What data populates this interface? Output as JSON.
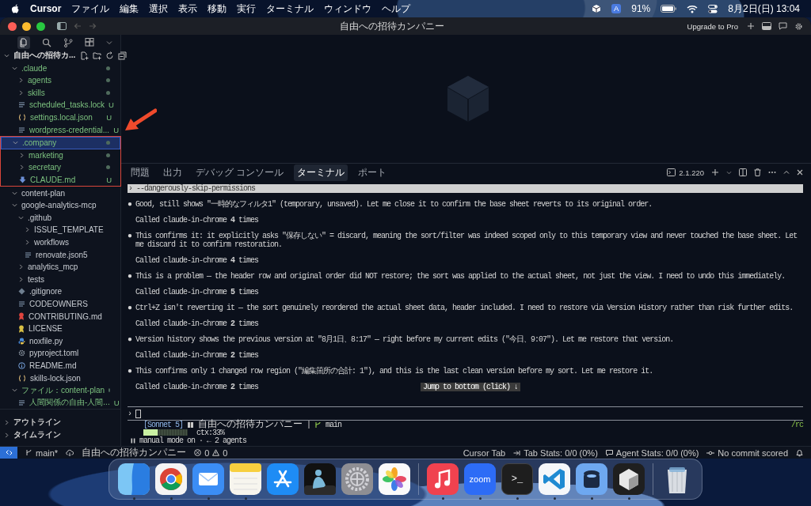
{
  "menubar": {
    "app": "Cursor",
    "menus": [
      "ファイル",
      "編集",
      "選択",
      "表示",
      "移動",
      "実行",
      "ターミナル",
      "ウィンドウ",
      "ヘルプ"
    ],
    "input_source": "A",
    "battery": "91%",
    "clock": "8月2日(日)  13:04"
  },
  "window": {
    "title": "自由への招待カンパニー",
    "upgrade": "Upgrade to Pro"
  },
  "sidebar": {
    "header": "自由への招待カ...",
    "tree": [
      {
        "name": ".claude",
        "kind": "folder",
        "expanded": true,
        "modified": true,
        "selected": false,
        "annotated": false,
        "children": [
          {
            "name": "agents",
            "kind": "folder",
            "expanded": false,
            "modified": true,
            "selected": false
          },
          {
            "name": "skills",
            "kind": "folder",
            "expanded": false,
            "modified": true,
            "selected": false
          },
          {
            "name": "scheduled_tasks.lock",
            "kind": "lines",
            "modified": false,
            "badge": "U",
            "selected": false
          },
          {
            "name": "settings.local.json",
            "kind": "braces",
            "modified": false,
            "badge": "U",
            "selected": false
          },
          {
            "name": "wordpress-credential...",
            "kind": "lines",
            "modified": false,
            "badge": "U",
            "selected": false
          }
        ]
      },
      {
        "name": ".company",
        "kind": "folder",
        "expanded": true,
        "modified": true,
        "selected": true,
        "annotated": true,
        "children": [
          {
            "name": "marketing",
            "kind": "folder",
            "expanded": false,
            "modified": true,
            "selected": false
          },
          {
            "name": "secretary",
            "kind": "folder",
            "expanded": false,
            "modified": true,
            "selected": false
          },
          {
            "name": "CLAUDE.md",
            "kind": "markdown",
            "modified": false,
            "badge": "U",
            "selected": false
          }
        ]
      },
      {
        "name": "content-plan",
        "kind": "folder",
        "expanded": true,
        "modified": false,
        "selected": false,
        "annotated": false
      },
      {
        "name": "google-analytics-mcp",
        "kind": "folder",
        "expanded": true,
        "modified": false,
        "selected": false,
        "annotated": false,
        "children": [
          {
            "name": ".github",
            "kind": "folder",
            "expanded": true,
            "modified": false,
            "selected": false,
            "children": [
              {
                "name": "ISSUE_TEMPLATE",
                "kind": "folder",
                "expanded": false,
                "modified": false,
                "selected": false
              },
              {
                "name": "workflows",
                "kind": "folder",
                "expanded": false,
                "modified": false,
                "selected": false
              },
              {
                "name": "renovate.json5",
                "kind": "lines",
                "modified": false,
                "selected": false
              }
            ]
          },
          {
            "name": "analytics_mcp",
            "kind": "folder",
            "expanded": false,
            "modified": false,
            "selected": false
          },
          {
            "name": "tests",
            "kind": "folder",
            "expanded": false,
            "modified": false,
            "selected": false
          },
          {
            "name": ".gitignore",
            "kind": "diamond",
            "modified": false,
            "selected": false
          },
          {
            "name": "CODEOWNERS",
            "kind": "lines",
            "modified": false,
            "selected": false
          },
          {
            "name": "CONTRIBUTING.md",
            "kind": "contributing",
            "modified": false,
            "selected": false
          },
          {
            "name": "LICENSE",
            "kind": "license",
            "modified": false,
            "selected": false
          },
          {
            "name": "noxfile.py",
            "kind": "python",
            "modified": false,
            "selected": false
          },
          {
            "name": "pyproject.toml",
            "kind": "toml",
            "modified": false,
            "selected": false
          },
          {
            "name": "README.md",
            "kind": "readme",
            "modified": false,
            "selected": false
          },
          {
            "name": "skills-lock.json",
            "kind": "braces",
            "modified": false,
            "selected": false
          }
        ]
      },
      {
        "name": "ファイル：content-plan",
        "kind": "folder",
        "expanded": true,
        "modified": true,
        "selected": false,
        "annotated": false,
        "children": [
          {
            "name": "人間関係の自由-人間...",
            "kind": "lines",
            "modified": false,
            "badge": "U",
            "selected": false
          }
        ]
      }
    ],
    "sections": [
      {
        "label": "アウトライン",
        "expanded": false
      },
      {
        "label": "タイムライン",
        "expanded": false
      }
    ]
  },
  "panel": {
    "tabs": [
      {
        "label": "問題",
        "selected": false
      },
      {
        "label": "出力",
        "selected": false
      },
      {
        "label": "デバッグ コンソール",
        "selected": false
      },
      {
        "label": "ターミナル",
        "selected": true
      },
      {
        "label": "ポート",
        "selected": false
      }
    ],
    "version": "2.1.220"
  },
  "terminal": {
    "lines": [
      {
        "kind": "command",
        "prompt": "›",
        "text": "--dangerously-skip-permissions"
      },
      {
        "kind": "bullet",
        "marker": "●",
        "text": "Good, still shows \"一時的なフィルタ1\" (temporary, unsaved). Let me close it to confirm the base sheet reverts to its original order."
      },
      {
        "kind": "called",
        "text": "Called claude-in-chrome **4** times"
      },
      {
        "kind": "bullet",
        "marker": "●",
        "text": "This confirms it: it explicitly asks \"保存しない\" = discard, meaning the sort/filter was indeed scoped only to this temporary view and never touched the base sheet. Let me discard it to confirm restoration."
      },
      {
        "kind": "called",
        "text": "Called claude-in-chrome **4** times"
      },
      {
        "kind": "bullet",
        "marker": "●",
        "text": "This is a problem — the header row and original order did NOT restore; the sort was applied to the actual sheet, not just the view. I need to undo this immediately."
      },
      {
        "kind": "called",
        "text": "Called claude-in-chrome **5** times"
      },
      {
        "kind": "bullet",
        "marker": "●",
        "text": "Ctrl+Z isn't reverting it — the sort genuinely reordered the actual sheet data, header included. I need to restore via Version History rather than risk further edits."
      },
      {
        "kind": "called",
        "text": "Called claude-in-chrome **2** times"
      },
      {
        "kind": "bullet",
        "marker": "●",
        "text": "Version history shows the previous version at \"8月1日、8:17\" — right before my current edits (\"今日、9:07\"). Let me restore that version."
      },
      {
        "kind": "called",
        "text": "Called claude-in-chrome **2** times"
      },
      {
        "kind": "bullet",
        "marker": "●",
        "text": "This confirms only 1 changed row region (\"編集箇所の合計: 1\"), and this is the last clean version before my sort. Let me restore it."
      },
      {
        "kind": "called",
        "text": "Called claude-in-chrome **2** times",
        "jump": "Jump to bottom (click) ↓"
      }
    ],
    "prompt": "›",
    "status": {
      "model": "[Sonnet 5]",
      "folder": "自由への招待カンパニー",
      "separator": "|",
      "branch": "main",
      "command": "/rc",
      "level": 0.33,
      "context": "ctx:33%",
      "mode": "manual mode on · ← 2 agents"
    }
  },
  "status_bar": {
    "branch": "main*",
    "workspace": "自由への招待カンパニー",
    "errors": "0",
    "warnings": "0",
    "right": [
      {
        "kind": "plain",
        "text": "Cursor Tab"
      },
      {
        "kind": "tab",
        "text": "Tab Stats: 0/0 (0%)"
      },
      {
        "kind": "agent",
        "text": "Agent Stats: 0/0 (0%)"
      },
      {
        "kind": "commit",
        "text": "No commit scored"
      }
    ]
  },
  "dock": {
    "apps": [
      {
        "kind": "finder",
        "running": true
      },
      {
        "kind": "chrome",
        "running": true
      },
      {
        "kind": "mail",
        "running": true
      },
      {
        "kind": "notes",
        "running": true
      },
      {
        "kind": "appstore",
        "running": false
      },
      {
        "kind": "kindle",
        "running": false
      },
      {
        "kind": "settings",
        "running": false
      },
      {
        "kind": "photos",
        "running": false
      }
    ],
    "recent": [
      {
        "kind": "music",
        "running": true
      },
      {
        "kind": "zoom",
        "label": "zoom",
        "running": true
      },
      {
        "kind": "terminal",
        "label": ">_",
        "running": true
      },
      {
        "kind": "vscode",
        "running": true
      },
      {
        "kind": "jar",
        "running": true
      },
      {
        "kind": "cube",
        "running": true
      }
    ],
    "trash": {
      "kind": "trash",
      "running": false
    }
  }
}
